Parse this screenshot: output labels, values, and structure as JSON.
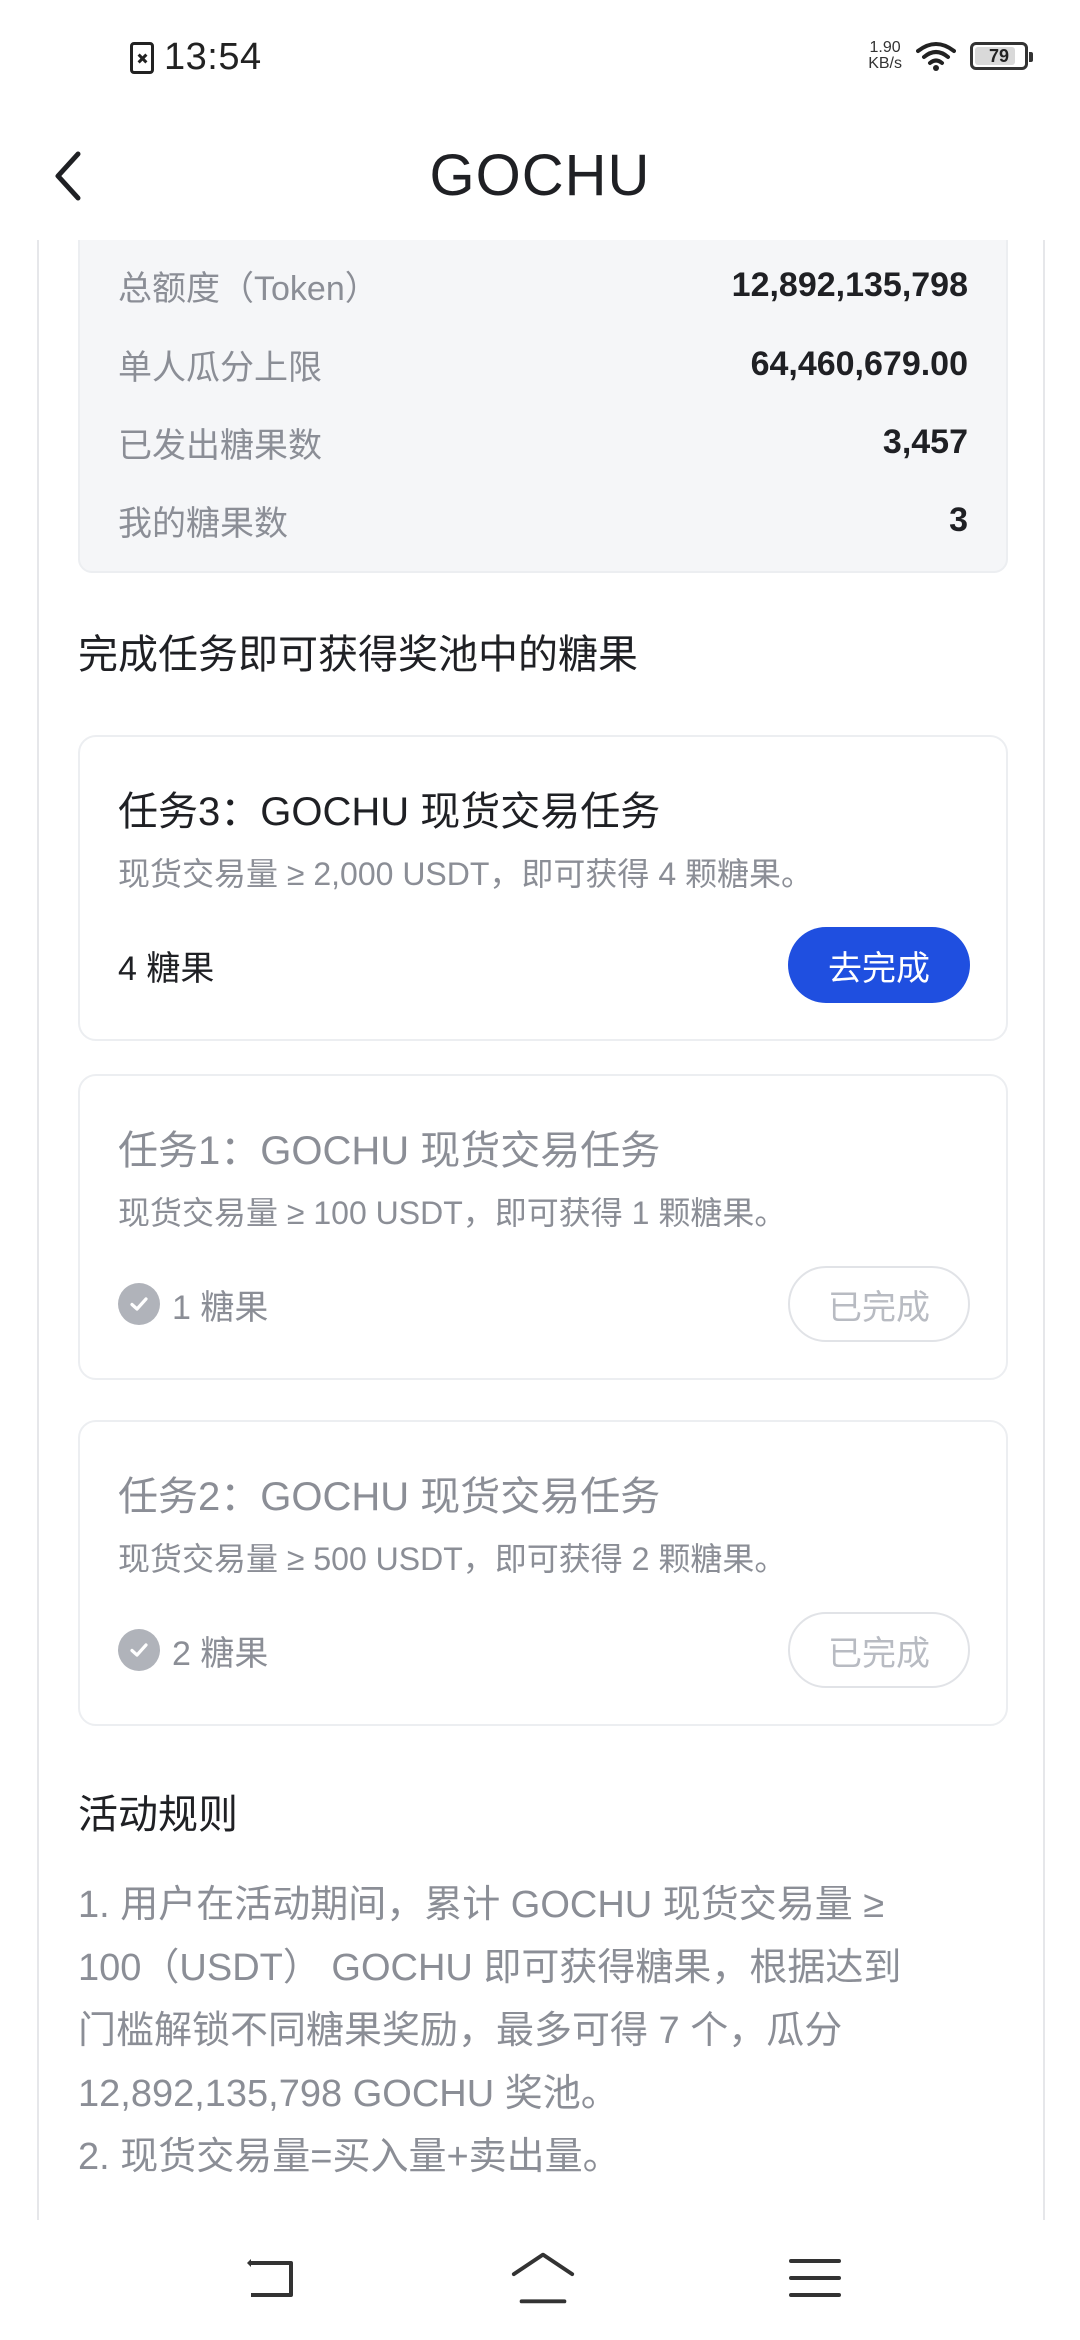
{
  "status_bar": {
    "time": "13:54",
    "net_speed_value": "1.90",
    "net_speed_unit": "KB/s",
    "battery_level": "79"
  },
  "header": {
    "title": "GOCHU"
  },
  "stats": [
    {
      "label": "总额度（Token）",
      "value": "12,892,135,798"
    },
    {
      "label": "单人瓜分上限",
      "value": "64,460,679.00"
    },
    {
      "label": "已发出糖果数",
      "value": "3,457"
    },
    {
      "label": "我的糖果数",
      "value": "3"
    }
  ],
  "tasks_heading": "完成任务即可获得奖池中的糖果",
  "tasks": [
    {
      "title": "任务3：GOCHU 现货交易任务",
      "description": "现货交易量 ≥ 2,000 USDT，即可获得 4 颗糖果。",
      "reward": "4 糖果",
      "button": "去完成",
      "completed": false
    },
    {
      "title": "任务1：GOCHU 现货交易任务",
      "description": "现货交易量 ≥ 100 USDT，即可获得 1 颗糖果。",
      "reward": "1 糖果",
      "button": "已完成",
      "completed": true
    },
    {
      "title": "任务2：GOCHU 现货交易任务",
      "description": "现货交易量 ≥ 500 USDT，即可获得 2 颗糖果。",
      "reward": "2 糖果",
      "button": "已完成",
      "completed": true
    }
  ],
  "rules": {
    "heading": "活动规则",
    "lines": [
      "1. 用户在活动期间，累计 GOCHU 现货交易量 ≥",
      "100（USDT） GOCHU 即可获得糖果，根据达到",
      "门槛解锁不同糖果奖励，最多可得 7 个，瓜分",
      "12,892,135,798 GOCHU 奖池。",
      "2. 现货交易量=买入量+卖出量。"
    ]
  },
  "colors": {
    "primary": "#1f4fe0",
    "text": "#1f2024",
    "muted": "#8b8e96"
  },
  "icons": {
    "back": "chevron-left-icon",
    "check": "check-circle-icon",
    "nav_back": "nav-back-icon",
    "nav_home": "nav-home-icon",
    "nav_menu": "nav-menu-icon"
  }
}
